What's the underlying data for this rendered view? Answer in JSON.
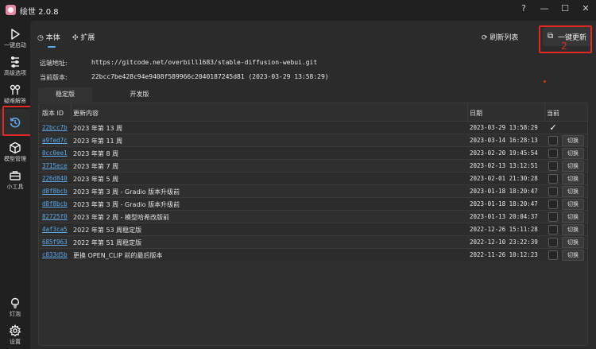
{
  "app": {
    "title": "绘世 2.0.8"
  },
  "window": {
    "help": "?",
    "minimize": "—",
    "maximize": "☐",
    "close": "✕"
  },
  "sidebar": {
    "items": [
      {
        "label": "一键启动",
        "icon": "play-icon"
      },
      {
        "label": "高级选项",
        "icon": "sliders-icon"
      },
      {
        "label": "疑难解答",
        "icon": "troubleshoot-icon"
      },
      {
        "label": "",
        "icon": "history-icon"
      },
      {
        "label": "模型管理",
        "icon": "cube-icon"
      },
      {
        "label": "小工具",
        "icon": "toolbox-icon"
      }
    ],
    "bottom": [
      {
        "label": "灯泡",
        "icon": "bulb-icon"
      },
      {
        "label": "设置",
        "icon": "gear-icon"
      }
    ]
  },
  "tabs": [
    {
      "label": "本体",
      "icon": "clock-icon"
    },
    {
      "label": "扩展",
      "icon": "puzzle-icon"
    }
  ],
  "actions": {
    "refresh": "刷新列表",
    "update": "一键更新"
  },
  "annotation": {
    "mark": "2"
  },
  "info": {
    "remote_label": "远端地址:",
    "remote_value": "https://gitcode.net/overbill1683/stable-diffusion-webui.git",
    "current_label": "当前版本:",
    "current_value": "22bcc7be428c94e9408f589966c2040187245d81 (2023-03-29 13:58:29)"
  },
  "sub_tabs": [
    "稳定版",
    "开发版"
  ],
  "table": {
    "headers": {
      "id": "版本 ID",
      "content": "更新内容",
      "date": "日期",
      "current": "当前"
    },
    "switch_label": "切换",
    "rows": [
      {
        "id": "22bcc7b",
        "content": "2023 年第 13 周",
        "date": "2023-03-29 13:58:29",
        "current": true
      },
      {
        "id": "a9fed7c",
        "content": "2023 年第 11 周",
        "date": "2023-03-14 16:28:13",
        "current": false
      },
      {
        "id": "0cc0ee1",
        "content": "2023 年第 8 周",
        "date": "2023-02-20 19:45:54",
        "current": false
      },
      {
        "id": "3715ece",
        "content": "2023 年第 7 周",
        "date": "2023-02-13 13:12:51",
        "current": false
      },
      {
        "id": "226d840",
        "content": "2023 年第 5 周",
        "date": "2023-02-01 21:30:28",
        "current": false
      },
      {
        "id": "d8f8bcb",
        "content": "2023 年第 3 周 - Gradio 版本升级前",
        "date": "2023-01-18 18:20:47",
        "current": false
      },
      {
        "id": "d8f8bcb",
        "content": "2023 年第 3 周 - Gradio 版本升级前",
        "date": "2023-01-18 18:20:47",
        "current": false
      },
      {
        "id": "82725f0",
        "content": "2023 年第 2 周 - 模型哈希改版前",
        "date": "2023-01-13 20:04:37",
        "current": false
      },
      {
        "id": "4af3ca5",
        "content": "2022 年第 53 周稳定版",
        "date": "2022-12-26 15:11:28",
        "current": false
      },
      {
        "id": "685f963",
        "content": "2022 年第 51 周稳定版",
        "date": "2022-12-10 23:22:39",
        "current": false
      },
      {
        "id": "c833d5b",
        "content": "更换 OPEN_CLIP 前的最后版本",
        "date": "2022-11-26 10:12:23",
        "current": false
      }
    ]
  }
}
